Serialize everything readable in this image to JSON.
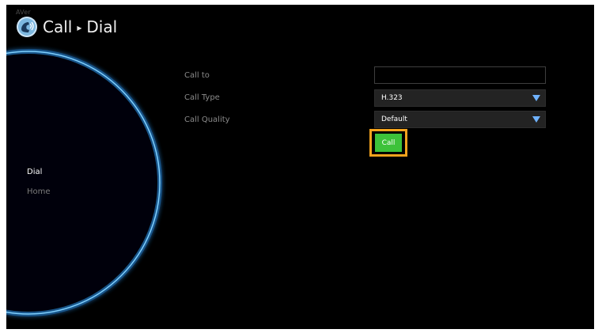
{
  "brand": "AVer",
  "header": {
    "icon": "phone-icon",
    "section": "Call",
    "separator": "▸",
    "page": "Dial"
  },
  "sidebar": {
    "items": [
      {
        "label": "Dial",
        "active": true
      },
      {
        "label": "Home",
        "active": false
      }
    ]
  },
  "form": {
    "call_to": {
      "label": "Call to",
      "value": ""
    },
    "call_type": {
      "label": "Call Type",
      "selected": "H.323"
    },
    "call_quality": {
      "label": "Call Quality",
      "selected": "Default"
    },
    "call_button_label": "Call"
  },
  "colors": {
    "background": "#000000",
    "arc_glow": "#3aa8ff",
    "highlight": "#f4a31d",
    "call_button": "#3dc23a",
    "dropdown_arrow": "#6fb2ff"
  }
}
